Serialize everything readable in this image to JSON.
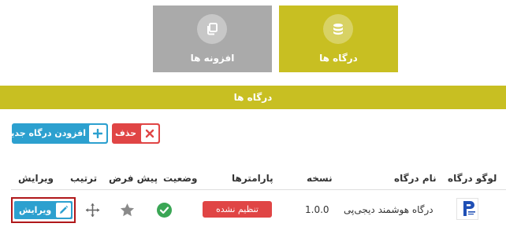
{
  "tiles": {
    "gateways_label": "درگاه ها",
    "addons_label": "افزونه ها",
    "gateways_icon": "database-icon",
    "addons_icon": "copy-icon"
  },
  "section_title": "درگاه ها",
  "actions": {
    "add_label": "افزودن درگاه جدید",
    "delete_label": "حذف"
  },
  "table": {
    "headers": [
      "لوگو درگاه",
      "نام درگاه",
      "نسخه",
      "پارامترها",
      "وضعیت",
      "پیش فرض",
      "ترتیب",
      "ویرایش"
    ],
    "rows": [
      {
        "name": "درگاه هوشمند دیجی‌پی",
        "version": "1.0.0",
        "params_status": "تنظیم نشده",
        "active": true,
        "is_default": false,
        "edit_label": "ویرایش"
      }
    ]
  },
  "colors": {
    "accent": "#c8bf22",
    "tile_inactive": "#aaaaaa",
    "primary": "#2ca0cf",
    "danger": "#e04545",
    "success": "#3aa655"
  }
}
